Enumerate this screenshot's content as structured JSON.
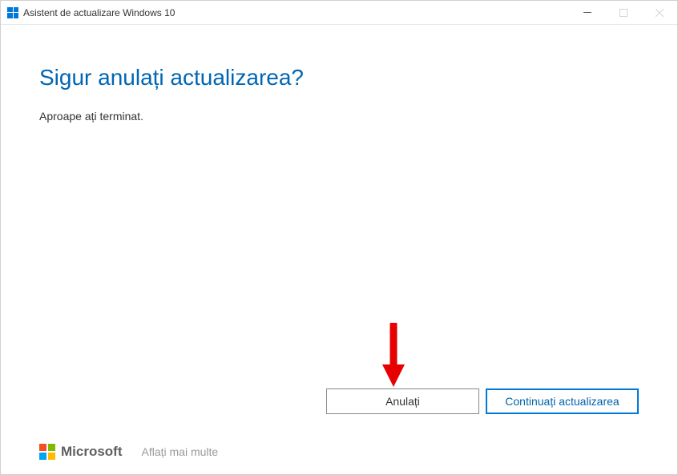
{
  "titlebar": {
    "app_title": "Asistent de actualizare Windows 10"
  },
  "main": {
    "heading": "Sigur anulați actualizarea?",
    "subtext": "Aproape ați terminat."
  },
  "buttons": {
    "cancel": "Anulați",
    "continue": "Continuați actualizarea"
  },
  "footer": {
    "brand": "Microsoft",
    "learn_more": "Aflați mai multe"
  }
}
